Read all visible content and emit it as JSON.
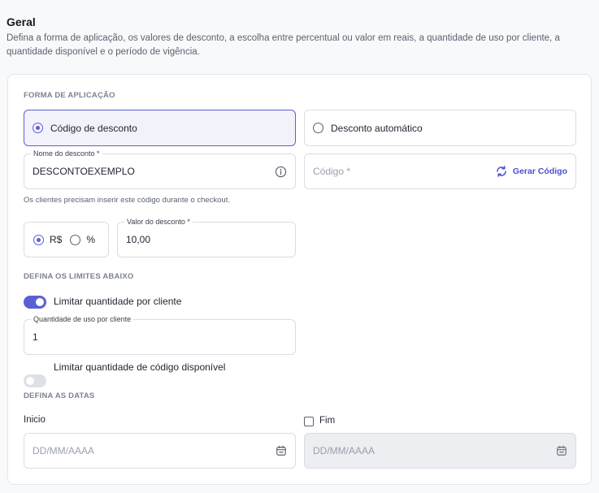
{
  "header": {
    "title": "Geral",
    "description": "Defina a forma de aplicação, os valores de desconto, a escolha entre percentual ou valor em reais, a quantidade de uso por cliente, a quantidade disponível e o período de vigência."
  },
  "application": {
    "section_label": "FORMA DE APLICAÇÃO",
    "options": [
      {
        "label": "Código de desconto",
        "selected": true
      },
      {
        "label": "Desconto automático",
        "selected": false
      }
    ]
  },
  "discount_name": {
    "label": "Nome do desconto *",
    "value": "DESCONTOEXEMPLO",
    "hint": "Os clientes precisam inserir este código durante o checkout."
  },
  "code": {
    "placeholder": "Código *",
    "generate_label": "Gerar Código"
  },
  "discount_type": {
    "options": [
      {
        "label": "R$",
        "selected": true
      },
      {
        "label": "%",
        "selected": false
      }
    ]
  },
  "discount_value": {
    "label": "Valor do desconto *",
    "value": "10,00"
  },
  "limits": {
    "section_label": "DEFINA OS LIMITES ABAIXO",
    "per_customer": {
      "label": "Limitar quantidade por cliente",
      "enabled": true
    },
    "usage_field": {
      "label": "Quantidade de uso por cliente",
      "value": "1"
    },
    "available": {
      "label": "Limitar quantidade de código disponível",
      "enabled": false
    }
  },
  "dates": {
    "section_label": "DEFINA AS DATAS",
    "start": {
      "label": "Inicio",
      "placeholder": "DD/MM/AAAA"
    },
    "end": {
      "label": "Fim",
      "checked": false,
      "placeholder": "DD/MM/AAAA"
    }
  },
  "colors": {
    "accent": "#5c5ed6",
    "accent_text": "#4a4fd1",
    "border": "#d9dde3"
  }
}
